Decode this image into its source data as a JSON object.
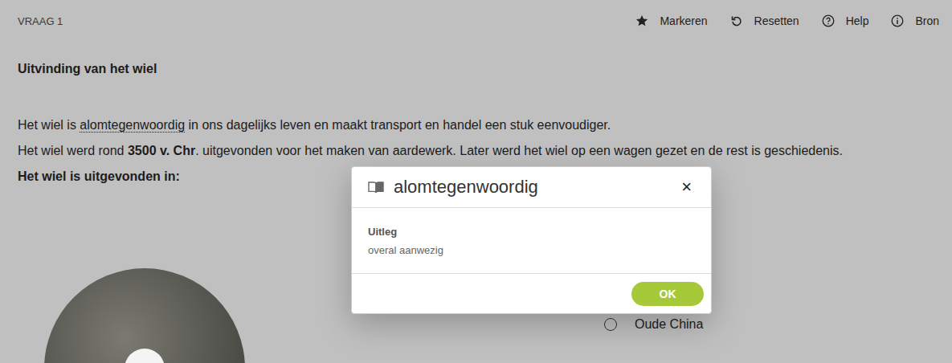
{
  "header": {
    "question": "VRAAG 1",
    "tools": [
      {
        "label": "Markeren",
        "kind": "star"
      },
      {
        "label": "Resetten",
        "kind": "reset"
      },
      {
        "label": "Help",
        "kind": "help"
      },
      {
        "label": "Bron",
        "kind": "info"
      }
    ]
  },
  "question": {
    "title": "Uitvinding van het wiel",
    "paragraphs": [
      [
        {
          "text": "Het wiel is ",
          "kind": "plain"
        },
        {
          "text": "alomtegenwoordig",
          "kind": "term"
        },
        {
          "text": " in ons dagelijks leven en maakt transport en handel een stuk eenvoudiger.",
          "kind": "plain"
        }
      ],
      [
        {
          "text": "Het wiel werd rond ",
          "kind": "plain"
        },
        {
          "text": "3500 v. Chr",
          "kind": "bold"
        },
        {
          "text": ". uitgevonden voor het maken van aardewerk. Later werd het wiel op een wagen gezet en de rest is geschiedenis.",
          "kind": "plain"
        }
      ]
    ],
    "prompt": "Het wiel is uitgevonden in:",
    "options": [
      {
        "label": "Oude China",
        "selected": false
      }
    ]
  },
  "dialog": {
    "title": "alomtegenwoordig",
    "close": "×",
    "section_label": "Uitleg",
    "explanation": "overal aanwezig",
    "button": "OK"
  }
}
